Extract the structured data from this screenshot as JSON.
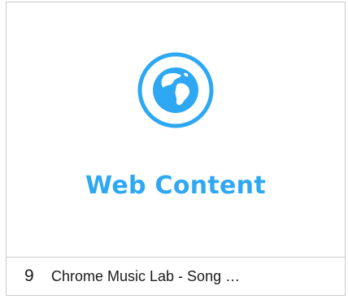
{
  "card": {
    "icon": "globe-icon",
    "accent_color": "#2ea8f2",
    "title": "Web Content",
    "number": "9",
    "item_title": "Chrome Music Lab - Song …"
  }
}
